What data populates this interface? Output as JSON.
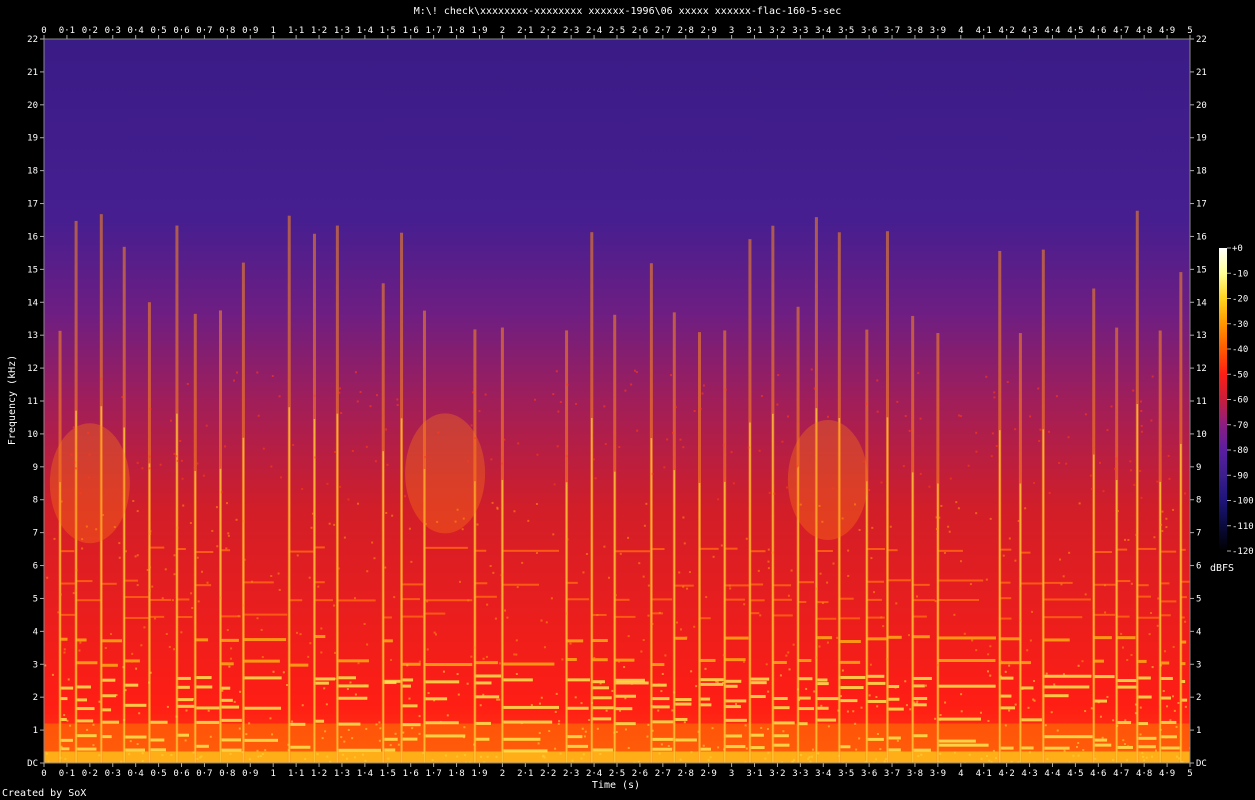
{
  "title": "M:\\! check\\xxxxxxxx-xxxxxxxx xxxxxx-1996\\06 xxxxx xxxxxx-flac-160-5-sec",
  "credit": "Created by SoX",
  "colors": {
    "background": "#000000",
    "palette": [
      "#000000",
      "#0a0a3c",
      "#1e147a",
      "#3c1e8c",
      "#5a1ea0",
      "#8c1e82",
      "#c81e3c",
      "#ff1e14",
      "#ff5a00",
      "#ff9600",
      "#ffd21e",
      "#ffff96",
      "#ffffff"
    ]
  },
  "chart_data": {
    "type": "heatmap",
    "xlabel": "Time (s)",
    "ylabel": "Frequency (kHz)",
    "xlim": [
      0,
      5
    ],
    "ylim": [
      0,
      22
    ],
    "x_ticks": [
      "0",
      "0·1",
      "0·2",
      "0·3",
      "0·4",
      "0·5",
      "0·6",
      "0·7",
      "0·8",
      "0·9",
      "1",
      "1·1",
      "1·2",
      "1·3",
      "1·4",
      "1·5",
      "1·6",
      "1·7",
      "1·8",
      "1·9",
      "2",
      "2·1",
      "2·2",
      "2·3",
      "2·4",
      "2·5",
      "2·6",
      "2·7",
      "2·8",
      "2·9",
      "3",
      "3·1",
      "3·2",
      "3·3",
      "3·4",
      "3·5",
      "3·6",
      "3·7",
      "3·8",
      "3·9",
      "4",
      "4·1",
      "4·2",
      "4·3",
      "4·4",
      "4·5",
      "4·6",
      "4·7",
      "4·8",
      "4·9",
      "5"
    ],
    "y_ticks": [
      "DC",
      "1",
      "2",
      "3",
      "4",
      "5",
      "6",
      "7",
      "8",
      "9",
      "10",
      "11",
      "12",
      "13",
      "14",
      "15",
      "16",
      "17",
      "18",
      "19",
      "20",
      "21",
      "22"
    ],
    "colorbar": {
      "label": "dBFS",
      "ticks": [
        "+0",
        "-10",
        "-20",
        "-30",
        "-40",
        "-50",
        "-60",
        "-70",
        "-80",
        "-90",
        "-100",
        "-110",
        "-120"
      ],
      "range": [
        -120,
        0
      ]
    },
    "onsets_s": [
      0.07,
      0.14,
      0.25,
      0.35,
      0.46,
      0.58,
      0.66,
      0.77,
      0.87,
      1.07,
      1.18,
      1.28,
      1.48,
      1.56,
      1.66,
      1.88,
      2.0,
      2.28,
      2.39,
      2.49,
      2.65,
      2.75,
      2.86,
      2.97,
      3.08,
      3.18,
      3.29,
      3.37,
      3.47,
      3.59,
      3.68,
      3.79,
      3.9,
      4.17,
      4.26,
      4.36,
      4.58,
      4.68,
      4.77,
      4.87,
      4.96
    ],
    "harmonic_bands_khz": [
      0.5,
      0.8,
      1.3,
      1.75,
      2.0,
      2.4,
      2.6,
      3.1,
      3.8,
      4.5,
      5.0,
      5.5,
      6.5
    ]
  }
}
